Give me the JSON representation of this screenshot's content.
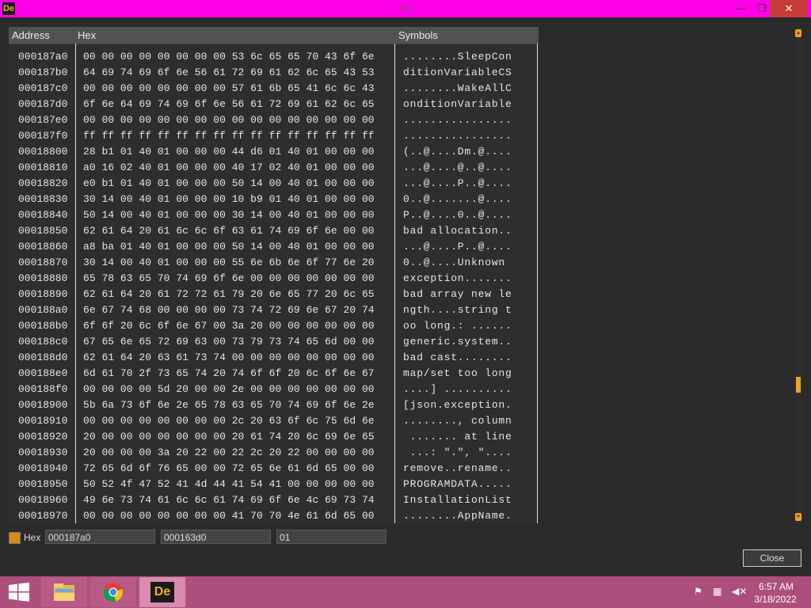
{
  "window": {
    "title": "die",
    "app_icon": "De",
    "minimize_glyph": "—",
    "maximize_glyph": "❐",
    "close_glyph": "✕"
  },
  "viewer": {
    "columns": {
      "address": "Address",
      "hex": "Hex",
      "symbols": "Symbols"
    },
    "rows": [
      {
        "address": "000187a0",
        "hex": "00 00 00 00 00 00 00 00 53 6c 65 65 70 43 6f 6e",
        "symbols": "........SleepCon"
      },
      {
        "address": "000187b0",
        "hex": "64 69 74 69 6f 6e 56 61 72 69 61 62 6c 65 43 53",
        "symbols": "ditionVariableCS"
      },
      {
        "address": "000187c0",
        "hex": "00 00 00 00 00 00 00 00 57 61 6b 65 41 6c 6c 43",
        "symbols": "........WakeAllC"
      },
      {
        "address": "000187d0",
        "hex": "6f 6e 64 69 74 69 6f 6e 56 61 72 69 61 62 6c 65",
        "symbols": "onditionVariable"
      },
      {
        "address": "000187e0",
        "hex": "00 00 00 00 00 00 00 00 00 00 00 00 00 00 00 00",
        "symbols": "................"
      },
      {
        "address": "000187f0",
        "hex": "ff ff ff ff ff ff ff ff ff ff ff ff ff ff ff ff",
        "symbols": "................"
      },
      {
        "address": "00018800",
        "hex": "28 b1 01 40 01 00 00 00 44 d6 01 40 01 00 00 00",
        "symbols": "(..@....Dm.@...."
      },
      {
        "address": "00018810",
        "hex": "a0 16 02 40 01 00 00 00 40 17 02 40 01 00 00 00",
        "symbols": "...@....@..@...."
      },
      {
        "address": "00018820",
        "hex": "e0 b1 01 40 01 00 00 00 50 14 00 40 01 00 00 00",
        "symbols": "...@....P..@...."
      },
      {
        "address": "00018830",
        "hex": "30 14 00 40 01 00 00 00 10 b9 01 40 01 00 00 00",
        "symbols": "0..@.......@...."
      },
      {
        "address": "00018840",
        "hex": "50 14 00 40 01 00 00 00 30 14 00 40 01 00 00 00",
        "symbols": "P..@....0..@...."
      },
      {
        "address": "00018850",
        "hex": "62 61 64 20 61 6c 6c 6f 63 61 74 69 6f 6e 00 00",
        "symbols": "bad allocation.."
      },
      {
        "address": "00018860",
        "hex": "a8 ba 01 40 01 00 00 00 50 14 00 40 01 00 00 00",
        "symbols": "...@....P..@...."
      },
      {
        "address": "00018870",
        "hex": "30 14 00 40 01 00 00 00 55 6e 6b 6e 6f 77 6e 20",
        "symbols": "0..@....Unknown "
      },
      {
        "address": "00018880",
        "hex": "65 78 63 65 70 74 69 6f 6e 00 00 00 00 00 00 00",
        "symbols": "exception......."
      },
      {
        "address": "00018890",
        "hex": "62 61 64 20 61 72 72 61 79 20 6e 65 77 20 6c 65",
        "symbols": "bad array new le"
      },
      {
        "address": "000188a0",
        "hex": "6e 67 74 68 00 00 00 00 73 74 72 69 6e 67 20 74",
        "symbols": "ngth....string t"
      },
      {
        "address": "000188b0",
        "hex": "6f 6f 20 6c 6f 6e 67 00 3a 20 00 00 00 00 00 00",
        "symbols": "oo long.: ......"
      },
      {
        "address": "000188c0",
        "hex": "67 65 6e 65 72 69 63 00 73 79 73 74 65 6d 00 00",
        "symbols": "generic.system.."
      },
      {
        "address": "000188d0",
        "hex": "62 61 64 20 63 61 73 74 00 00 00 00 00 00 00 00",
        "symbols": "bad cast........"
      },
      {
        "address": "000188e0",
        "hex": "6d 61 70 2f 73 65 74 20 74 6f 6f 20 6c 6f 6e 67",
        "symbols": "map/set too long"
      },
      {
        "address": "000188f0",
        "hex": "00 00 00 00 5d 20 00 00 2e 00 00 00 00 00 00 00",
        "symbols": "....] .........."
      },
      {
        "address": "00018900",
        "hex": "5b 6a 73 6f 6e 2e 65 78 63 65 70 74 69 6f 6e 2e",
        "symbols": "[json.exception."
      },
      {
        "address": "00018910",
        "hex": "00 00 00 00 00 00 00 00 2c 20 63 6f 6c 75 6d 6e",
        "symbols": "........, column"
      },
      {
        "address": "00018920",
        "hex": "20 00 00 00 00 00 00 00 20 61 74 20 6c 69 6e 65",
        "symbols": " ....... at line"
      },
      {
        "address": "00018930",
        "hex": "20 00 00 00 3a 20 22 00 22 2c 20 22 00 00 00 00",
        "symbols": " ...: \".\", \"...."
      },
      {
        "address": "00018940",
        "hex": "72 65 6d 6f 76 65 00 00 72 65 6e 61 6d 65 00 00",
        "symbols": "remove..rename.."
      },
      {
        "address": "00018950",
        "hex": "50 52 4f 47 52 41 4d 44 41 54 41 00 00 00 00 00",
        "symbols": "PROGRAMDATA....."
      },
      {
        "address": "00018960",
        "hex": "49 6e 73 74 61 6c 6c 61 74 69 6f 6e 4c 69 73 74",
        "symbols": "InstallationList"
      },
      {
        "address": "00018970",
        "hex": "00 00 00 00 00 00 00 00 41 70 70 4e 61 6d 65 00",
        "symbols": "........AppName."
      }
    ]
  },
  "controls": {
    "hex_label": "Hex",
    "address_value": "000187a0",
    "size_value": "000163d0",
    "value_value": "01",
    "close_label": "Close"
  },
  "taskbar": {
    "time": "6:57 AM",
    "date": "3/18/2022",
    "die_icon": "De"
  },
  "colors": {
    "titlebar": "#ff00e8",
    "taskbar": "#ad4f7c",
    "accent": "#f0a020"
  }
}
